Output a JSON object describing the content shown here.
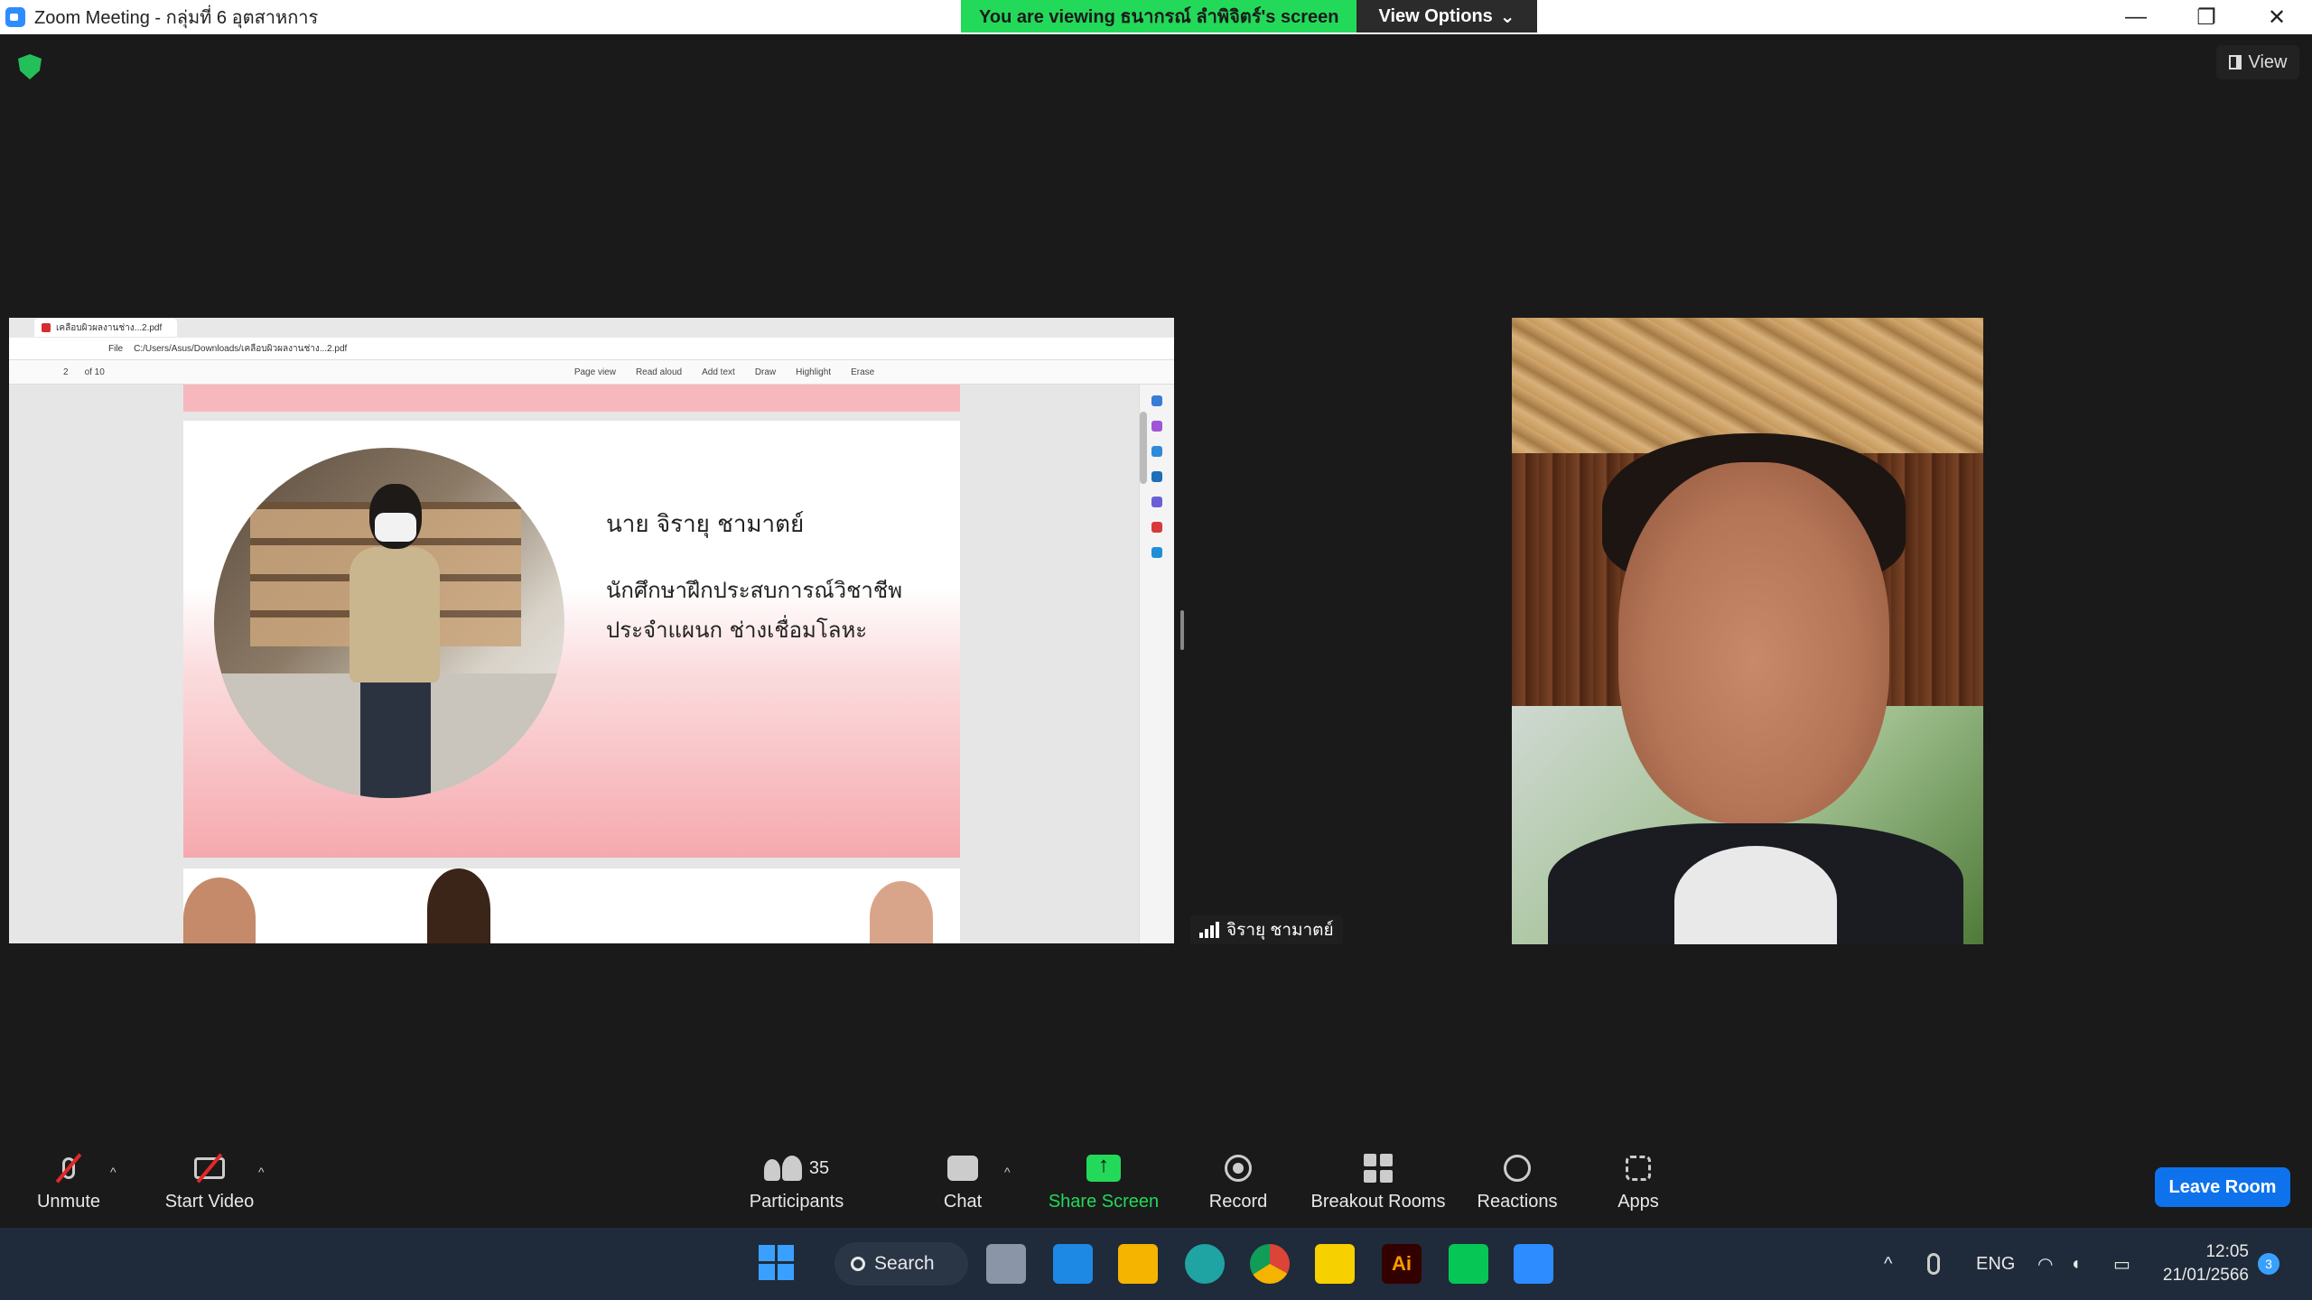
{
  "window": {
    "title": "Zoom Meeting - กลุ่มที่ 6 อุตสาหการ",
    "controls": [
      "—",
      "❐",
      "✕"
    ]
  },
  "banner": {
    "viewing": "You are viewing ธนากรณ์ ลำพิจิตร์'s screen",
    "view_options": "View Options",
    "chevron": "⌄"
  },
  "view_button": {
    "label": "View"
  },
  "shared_screen": {
    "tab_title": "เคลือบผิวผลงานช่าง...2.pdf",
    "url": "C:/Users/Asus/Downloads/เคลือบผิวผลงานช่าง...2.pdf",
    "file_label": "File",
    "page_current": "2",
    "page_total": "of 10",
    "tools": [
      "Page view",
      "Read aloud",
      "Add text",
      "Draw",
      "Highlight",
      "Erase"
    ],
    "slide": {
      "name": "นาย จิรายุ ชามาตย์",
      "position_line1": "นักศึกษาฝึกประสบการณ์วิชาชีพ",
      "position_line2": "ประจำแผนก ช่างเชื่อมโลหะ"
    }
  },
  "participant_video": {
    "name": "จิรายุ ชามาตย์"
  },
  "toolbar": {
    "unmute": "Unmute",
    "start_video": "Start Video",
    "participants": "Participants",
    "participants_count": "35",
    "chat": "Chat",
    "share_screen": "Share Screen",
    "record": "Record",
    "breakout_rooms": "Breakout Rooms",
    "reactions": "Reactions",
    "apps": "Apps",
    "leave": "Leave Room",
    "caret": "^"
  },
  "taskbar": {
    "search": "Search",
    "apps": [
      "windows-start",
      "task-view",
      "l-app",
      "file-explorer",
      "edge",
      "chrome",
      "sticky-notes",
      "illustrator",
      "line",
      "zoom"
    ],
    "tray_lang": "ENG",
    "tray_chevron": "^",
    "time": "12:05",
    "date": "21/01/2566",
    "notifications": "3"
  },
  "colors": {
    "accent_green": "#23d959",
    "leave_blue": "#0e72ed",
    "muted_red": "#e02828"
  }
}
